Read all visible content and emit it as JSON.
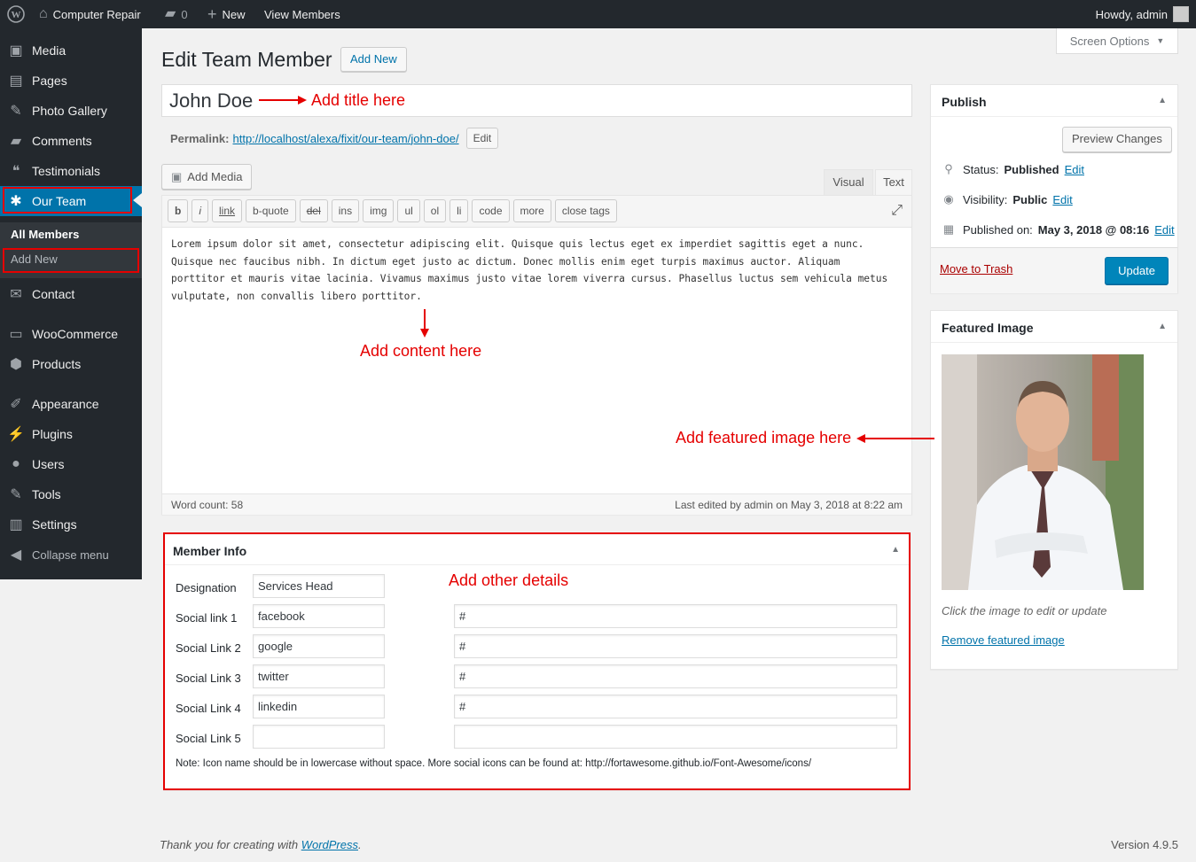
{
  "adminbar": {
    "site_name": "Computer Repair",
    "comments_count": "0",
    "new_label": "New",
    "view_label": "View Members",
    "howdy": "Howdy, admin"
  },
  "sidebar": {
    "items": [
      {
        "label": "Media",
        "icon": "media-icon"
      },
      {
        "label": "Pages",
        "icon": "pages-icon"
      },
      {
        "label": "Photo Gallery",
        "icon": "pin-icon"
      },
      {
        "label": "Comments",
        "icon": "comments-icon"
      },
      {
        "label": "Testimonials",
        "icon": "quote-icon"
      },
      {
        "label": "Our Team",
        "icon": "team-icon"
      },
      {
        "label": "Contact",
        "icon": "mail-icon"
      },
      {
        "label": "WooCommerce",
        "icon": "woo-icon"
      },
      {
        "label": "Products",
        "icon": "box-icon"
      },
      {
        "label": "Appearance",
        "icon": "brush-icon"
      },
      {
        "label": "Plugins",
        "icon": "plug-icon"
      },
      {
        "label": "Users",
        "icon": "user-icon"
      },
      {
        "label": "Tools",
        "icon": "wrench-icon"
      },
      {
        "label": "Settings",
        "icon": "settings-icon"
      },
      {
        "label": "Collapse menu",
        "icon": "collapse-icon"
      }
    ],
    "submenu": {
      "all_members": "All Members",
      "add_new": "Add New"
    }
  },
  "header": {
    "title": "Edit Team Member",
    "add_new": "Add New",
    "screen_options": "Screen Options"
  },
  "post": {
    "title": "John Doe",
    "permalink_label": "Permalink:",
    "permalink_url": "http://localhost/alexa/fixit/our-team/john-doe/",
    "permalink_edit": "Edit"
  },
  "editor": {
    "add_media": "Add Media",
    "tab_visual": "Visual",
    "tab_text": "Text",
    "quicktags": [
      "b",
      "i",
      "link",
      "b-quote",
      "del",
      "ins",
      "img",
      "ul",
      "ol",
      "li",
      "code",
      "more",
      "close tags"
    ],
    "content": "Lorem ipsum dolor sit amet, consectetur adipiscing elit. Quisque quis lectus eget ex imperdiet sagittis eget a nunc. Quisque nec faucibus nibh. In dictum eget justo ac dictum. Donec mollis enim eget turpis maximus auctor. Aliquam porttitor et mauris vitae lacinia. Vivamus maximus justo vitae lorem viverra cursus. Phasellus luctus sem vehicula metus vulputate, non convallis libero porttitor.",
    "word_count": "Word count: 58",
    "last_edited": "Last edited by admin on May 3, 2018 at 8:22 am"
  },
  "annotations": {
    "title": "Add title here",
    "content": "Add content here",
    "featured": "Add featured image here",
    "details": "Add other details",
    "color": "#e50000"
  },
  "member_info": {
    "heading": "Member Info",
    "designation_label": "Designation",
    "designation_value": "Services Head",
    "social": [
      {
        "label": "Social link 1",
        "name": "facebook",
        "url": "#"
      },
      {
        "label": "Social Link 2",
        "name": "google",
        "url": "#"
      },
      {
        "label": "Social Link 3",
        "name": "twitter",
        "url": "#"
      },
      {
        "label": "Social Link 4",
        "name": "linkedin",
        "url": "#"
      },
      {
        "label": "Social Link 5",
        "name": "",
        "url": ""
      }
    ],
    "note": "Note: Icon name should be in lowercase without space. More social icons can be found at: http://fortawesome.github.io/Font-Awesome/icons/"
  },
  "publish": {
    "heading": "Publish",
    "preview": "Preview Changes",
    "status_label": "Status:",
    "status_value": "Published",
    "visibility_label": "Visibility:",
    "visibility_value": "Public",
    "published_label": "Published on:",
    "published_value": "May 3, 2018 @ 08:16",
    "edit": "Edit",
    "trash": "Move to Trash",
    "update": "Update"
  },
  "featured_image": {
    "heading": "Featured Image",
    "hint": "Click the image to edit or update",
    "remove": "Remove featured image"
  },
  "footer": {
    "thanks": "Thank you for creating with ",
    "wp_link": "WordPress",
    "version": "Version 4.9.5"
  },
  "colors": {
    "accent": "#0073aa",
    "sidebar": "#23282d",
    "update_button": "#0085ba"
  }
}
